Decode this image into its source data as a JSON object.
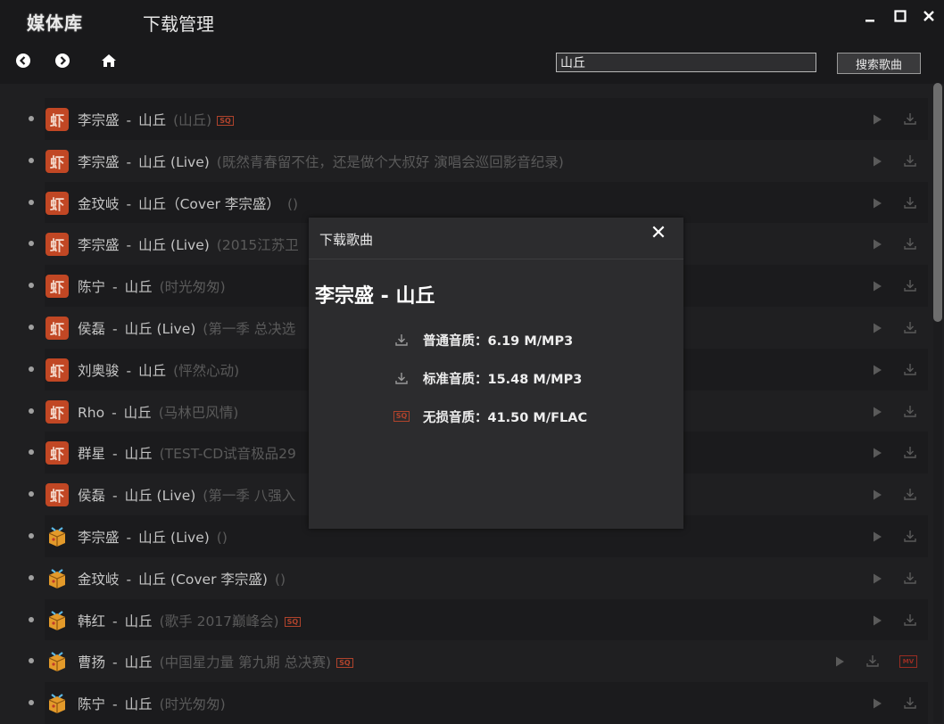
{
  "header": {
    "library_tab": "媒体库",
    "download_tab": "下载管理"
  },
  "search": {
    "value": "山丘",
    "button_label": "搜索歌曲"
  },
  "songs": [
    {
      "source": "red",
      "source_glyph": "虾",
      "artist": "李宗盛",
      "title": "山丘",
      "album": "(山丘)",
      "sq": "SQ",
      "mv": ""
    },
    {
      "source": "red",
      "source_glyph": "虾",
      "artist": "李宗盛",
      "title": "山丘 (Live)",
      "album": "(既然青春留不住，还是做个大叔好 演唱会巡回影音纪录)",
      "sq": "",
      "mv": ""
    },
    {
      "source": "red",
      "source_glyph": "虾",
      "artist": "金玟岐",
      "title": "山丘（Cover 李宗盛）",
      "album": "()",
      "sq": "",
      "mv": ""
    },
    {
      "source": "red",
      "source_glyph": "虾",
      "artist": "李宗盛",
      "title": "山丘 (Live)",
      "album": "(2015江苏卫",
      "sq": "",
      "mv": ""
    },
    {
      "source": "red",
      "source_glyph": "虾",
      "artist": "陈宁",
      "title": "山丘",
      "album": "(时光匆匆)",
      "sq": "",
      "mv": ""
    },
    {
      "source": "red",
      "source_glyph": "虾",
      "artist": "侯磊",
      "title": "山丘 (Live)",
      "album": "(第一季 总决选",
      "sq": "",
      "mv": ""
    },
    {
      "source": "red",
      "source_glyph": "虾",
      "artist": "刘奥骏",
      "title": "山丘",
      "album": "(怦然心动)",
      "sq": "",
      "mv": ""
    },
    {
      "source": "red",
      "source_glyph": "虾",
      "artist": "Rho",
      "title": "山丘",
      "album": "(马林巴风情)",
      "sq": "",
      "mv": ""
    },
    {
      "source": "red",
      "source_glyph": "虾",
      "artist": "群星",
      "title": "山丘",
      "album": "(TEST-CD试音极品29",
      "sq": "",
      "mv": ""
    },
    {
      "source": "red",
      "source_glyph": "虾",
      "artist": "侯磊",
      "title": "山丘 (Live)",
      "album": "(第一季 八强入",
      "sq": "",
      "mv": ""
    },
    {
      "source": "box",
      "source_glyph": "",
      "artist": "李宗盛",
      "title": "山丘 (Live)",
      "album": "()",
      "sq": "",
      "mv": ""
    },
    {
      "source": "box",
      "source_glyph": "",
      "artist": "金玟岐",
      "title": "山丘 (Cover 李宗盛)",
      "album": "()",
      "sq": "",
      "mv": ""
    },
    {
      "source": "box",
      "source_glyph": "",
      "artist": "韩红",
      "title": "山丘",
      "album": "(歌手 2017巅峰会)",
      "sq": "SQ",
      "mv": ""
    },
    {
      "source": "box",
      "source_glyph": "",
      "artist": "曹扬",
      "title": "山丘",
      "album": "(中国星力量 第九期 总决赛)",
      "sq": "SQ",
      "mv": "MV"
    },
    {
      "source": "box",
      "source_glyph": "",
      "artist": "陈宁",
      "title": "山丘",
      "album": "(时光匆匆)",
      "sq": "",
      "mv": ""
    }
  ],
  "dialog": {
    "title": "下载歌曲",
    "close_glyph": "✕",
    "song": "李宗盛 - 山丘",
    "options": [
      {
        "label": "普通音质：6.19 M/MP3",
        "icon": "download-icon"
      },
      {
        "label": "标准音质：15.48 M/MP3",
        "icon": "download-icon"
      },
      {
        "label": "无损音质：41.50 M/FLAC",
        "icon": "sq-badge-icon",
        "badge": "SQ"
      }
    ]
  },
  "colors": {
    "background": "#1f1f21",
    "dialog": "#2c2c2e",
    "accent_red": "#c14724"
  }
}
